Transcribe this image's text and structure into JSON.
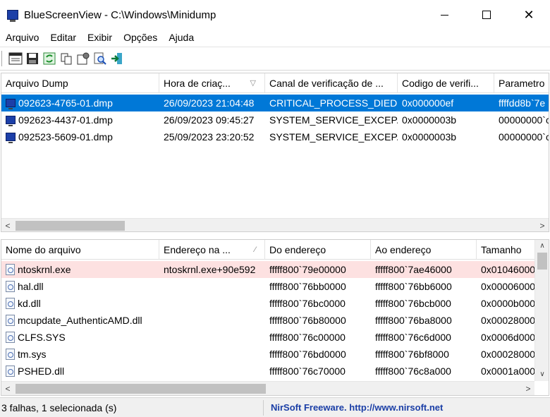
{
  "window": {
    "title": "BlueScreenView  -  C:\\Windows\\Minidump"
  },
  "menu": [
    "Arquivo",
    "Editar",
    "Exibir",
    "Opções",
    "Ajuda"
  ],
  "toolbar_icons": [
    "properties-icon",
    "save-icon",
    "refresh-icon",
    "copy-icon",
    "options-icon",
    "find-icon",
    "exit-icon"
  ],
  "top_table": {
    "columns": [
      "Arquivo Dump",
      "Hora de criaç...",
      "Canal de verificação de ...",
      "Codigo de verifi...",
      "Parametro"
    ],
    "rows": [
      [
        "092623-4765-01.dmp",
        "26/09/2023 21:04:48",
        "CRITICAL_PROCESS_DIED",
        "0x000000ef",
        "ffffdd8b`7e"
      ],
      [
        "092623-4437-01.dmp",
        "26/09/2023 09:45:27",
        "SYSTEM_SERVICE_EXCEP...",
        "0x0000003b",
        "00000000`c"
      ],
      [
        "092523-5609-01.dmp",
        "25/09/2023 23:20:52",
        "SYSTEM_SERVICE_EXCEP...",
        "0x0000003b",
        "00000000`c"
      ]
    ],
    "selected_index": 0
  },
  "bottom_table": {
    "columns": [
      "Nome do arquivo",
      "Endereço na ...",
      "Do endereço",
      "Ao endereço",
      "Tamanho"
    ],
    "rows": [
      [
        "ntoskrnl.exe",
        "ntoskrnl.exe+90e592",
        "fffff800`79e00000",
        "fffff800`7ae46000",
        "0x01046000"
      ],
      [
        "hal.dll",
        "",
        "fffff800`76bb0000",
        "fffff800`76bb6000",
        "0x00006000"
      ],
      [
        "kd.dll",
        "",
        "fffff800`76bc0000",
        "fffff800`76bcb000",
        "0x0000b000"
      ],
      [
        "mcupdate_AuthenticAMD.dll",
        "",
        "fffff800`76b80000",
        "fffff800`76ba8000",
        "0x00028000"
      ],
      [
        "CLFS.SYS",
        "",
        "fffff800`76c00000",
        "fffff800`76c6d000",
        "0x0006d000"
      ],
      [
        "tm.sys",
        "",
        "fffff800`76bd0000",
        "fffff800`76bf8000",
        "0x00028000"
      ],
      [
        "PSHED.dll",
        "",
        "fffff800`76c70000",
        "fffff800`76c8a000",
        "0x0001a000"
      ]
    ],
    "highlight_index": 0
  },
  "status": {
    "left": "3 falhas, 1 selecionada (s)",
    "right": "NirSoft Freeware.  http://www.nirsoft.net"
  },
  "colors": {
    "selection": "#0078d7",
    "highlight_row": "#fde1e1",
    "link": "#1a3ea6"
  }
}
